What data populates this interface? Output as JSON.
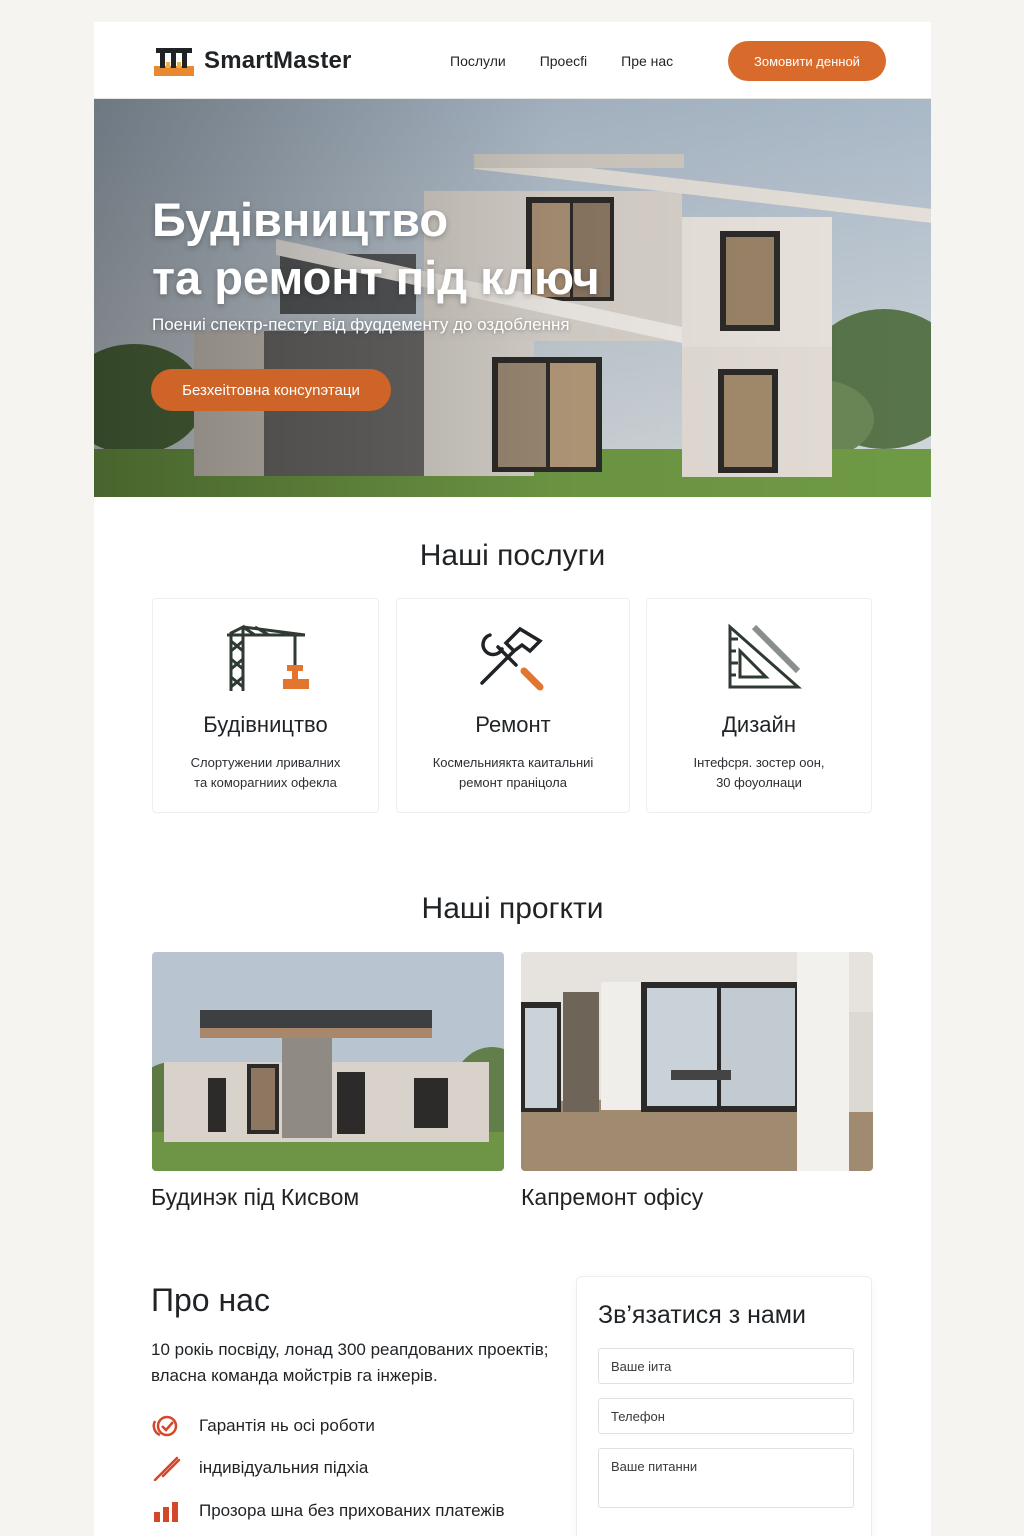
{
  "header": {
    "brand": "SmartMaster",
    "nav": [
      "Послули",
      "Проесfi",
      "Пре нас"
    ],
    "cta": "Зомовити денной"
  },
  "hero": {
    "title_line1": "Будівництво",
    "title_line2": "та ремонт під ключ",
    "subtitle": "Поениi спектр-пестуг від фуqдементу до оздоблення",
    "button": "Безхеitтовна консуnэтаци"
  },
  "services": {
    "title": "Наші послуги",
    "items": [
      {
        "icon": "crane-icon",
        "title": "Будівництво",
        "line1": "Слортужeнии лривалних",
        "line2": "та коморагниих офекла"
      },
      {
        "icon": "hammer-wrench-icon",
        "title": "Ремонт",
        "line1": "Космельниякта каитальниi",
        "line2": "ремонт праніцола"
      },
      {
        "icon": "set-square-icon",
        "title": "Дизайн",
        "line1": "Інтефсря. зостер оон,",
        "line2": "30 фоуолнаци"
      }
    ]
  },
  "projects": {
    "title": "Наші прогкти",
    "items": [
      {
        "image": "house-photo",
        "caption": "Будинэк під Кисвом"
      },
      {
        "image": "office-photo",
        "caption": "Капремонт офісу"
      }
    ]
  },
  "about": {
    "title": "Про нас",
    "text": "10 рокiь посвіду, лонад 300 реапдованих проектів; власна команда мойстрів га інжерів.",
    "features": [
      {
        "icon": "guarantee-icon",
        "text": "Гарантія нь осі роботи"
      },
      {
        "icon": "pencil-icon",
        "text": "індивідуальния підхіа"
      },
      {
        "icon": "chart-bars-icon",
        "text": "Прозора шна без прихованих платежів"
      }
    ]
  },
  "contact": {
    "title": "Зв’язатися з нами",
    "name_placeholder": "Ваше іита",
    "phone_placeholder": "Телефон",
    "question_placeholder": "Ваше питанни"
  },
  "colors": {
    "accent": "#d86b2b",
    "text": "#1f2326",
    "background": "#f6f4f1"
  }
}
